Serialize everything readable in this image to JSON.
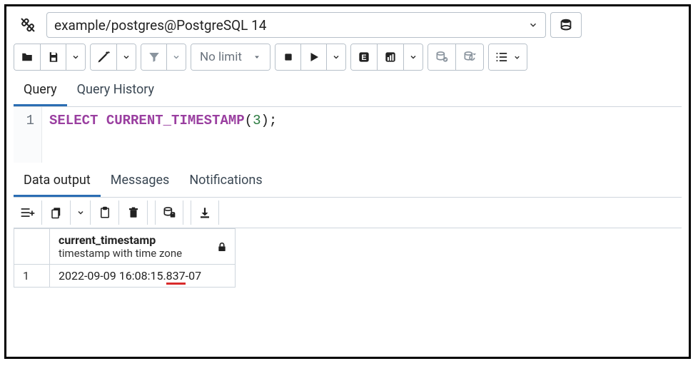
{
  "connection": {
    "label": "example/postgres@PostgreSQL 14"
  },
  "toolbar": {
    "limit_label": "No limit"
  },
  "editor_tabs": {
    "query": "Query",
    "history": "Query History"
  },
  "editor": {
    "line_number": "1",
    "code_tokens": {
      "select": "SELECT",
      "space1": " ",
      "func": "CURRENT_TIMESTAMP",
      "lparen": "(",
      "arg": "3",
      "rparen": ")",
      "semi": ";"
    }
  },
  "output_tabs": {
    "data": "Data output",
    "messages": "Messages",
    "notifications": "Notifications"
  },
  "result": {
    "column": {
      "name": "current_timestamp",
      "type": "timestamp with time zone"
    },
    "row_index": "1",
    "value_pre": "2022-09-09 16:08:15.",
    "value_underlined": "837",
    "value_post": "-07"
  }
}
